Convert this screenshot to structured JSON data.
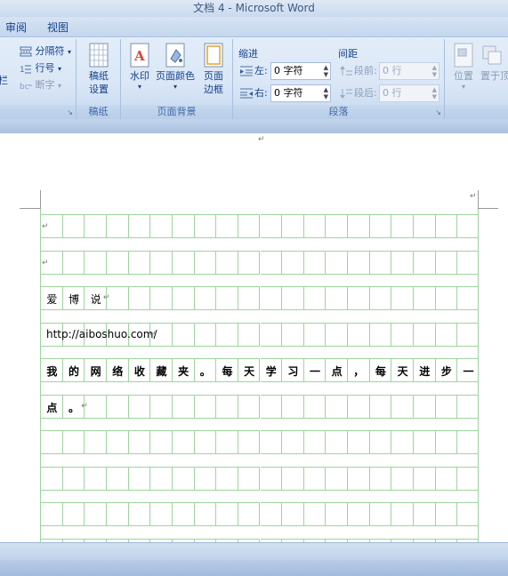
{
  "window": {
    "title": "文档 4 - Microsoft Word"
  },
  "tabs": [
    {
      "label": "审阅"
    },
    {
      "label": "视图"
    }
  ],
  "ribbon": {
    "page_setup_partial": {
      "items": [
        {
          "label": "分隔符",
          "caret": "▾"
        },
        {
          "label": "行号",
          "caret": "▾"
        },
        {
          "label": "断字",
          "caret": "▾"
        }
      ],
      "left_partial_label": "栏",
      "launcher": "↘"
    },
    "manuscript": {
      "buttons": [
        {
          "label": "稿纸\n设置"
        }
      ],
      "group_label": "稿纸"
    },
    "page_background": {
      "buttons": [
        {
          "label": "水印",
          "caret": "▾"
        },
        {
          "label": "页面颜色",
          "caret": "▾"
        },
        {
          "label": "页面\n边框"
        }
      ],
      "group_label": "页面背景"
    },
    "paragraph": {
      "indent_header": "缩进",
      "indent_left_label": "左:",
      "indent_left_value": "0 字符",
      "indent_right_label": "右:",
      "indent_right_value": "0 字符",
      "spacing_header": "间距",
      "spacing_before_label": "段前:",
      "spacing_before_value": "0 行",
      "spacing_after_label": "段后:",
      "spacing_after_value": "0 行",
      "group_label": "段落",
      "launcher": "↘"
    },
    "arrange_partial": {
      "buttons": [
        {
          "label": "位置",
          "caret": "▾"
        },
        {
          "label": "置于顶"
        }
      ]
    }
  },
  "document": {
    "paragraph_mark": "↵",
    "rows": [
      {
        "kind": "mark"
      },
      {
        "kind": "mark"
      },
      {
        "kind": "chars",
        "chars": [
          "爱",
          "博",
          "说"
        ],
        "bold": false
      },
      {
        "kind": "text",
        "text": "http://aiboshuo.com/"
      },
      {
        "kind": "chars",
        "chars": [
          "我",
          "的",
          "网",
          "络",
          "收",
          "藏",
          "夹",
          "。",
          "每",
          "天",
          "学",
          "习",
          "一",
          "点",
          "，",
          "每",
          "天",
          "进",
          "步",
          "一"
        ],
        "bold": true
      },
      {
        "kind": "chars",
        "chars": [
          "点",
          "。"
        ],
        "bold": true
      }
    ]
  },
  "colors": {
    "grid_line": "#9ed49e",
    "ribbon_accent": "#15428b"
  },
  "icons": [
    "section-break-icon",
    "line-numbers-icon",
    "hyphenation-icon",
    "manuscript-icon",
    "watermark-icon",
    "page-color-icon",
    "page-border-icon",
    "indent-left-icon",
    "indent-right-icon",
    "spacing-before-icon",
    "spacing-after-icon",
    "position-icon",
    "bring-to-front-icon"
  ]
}
